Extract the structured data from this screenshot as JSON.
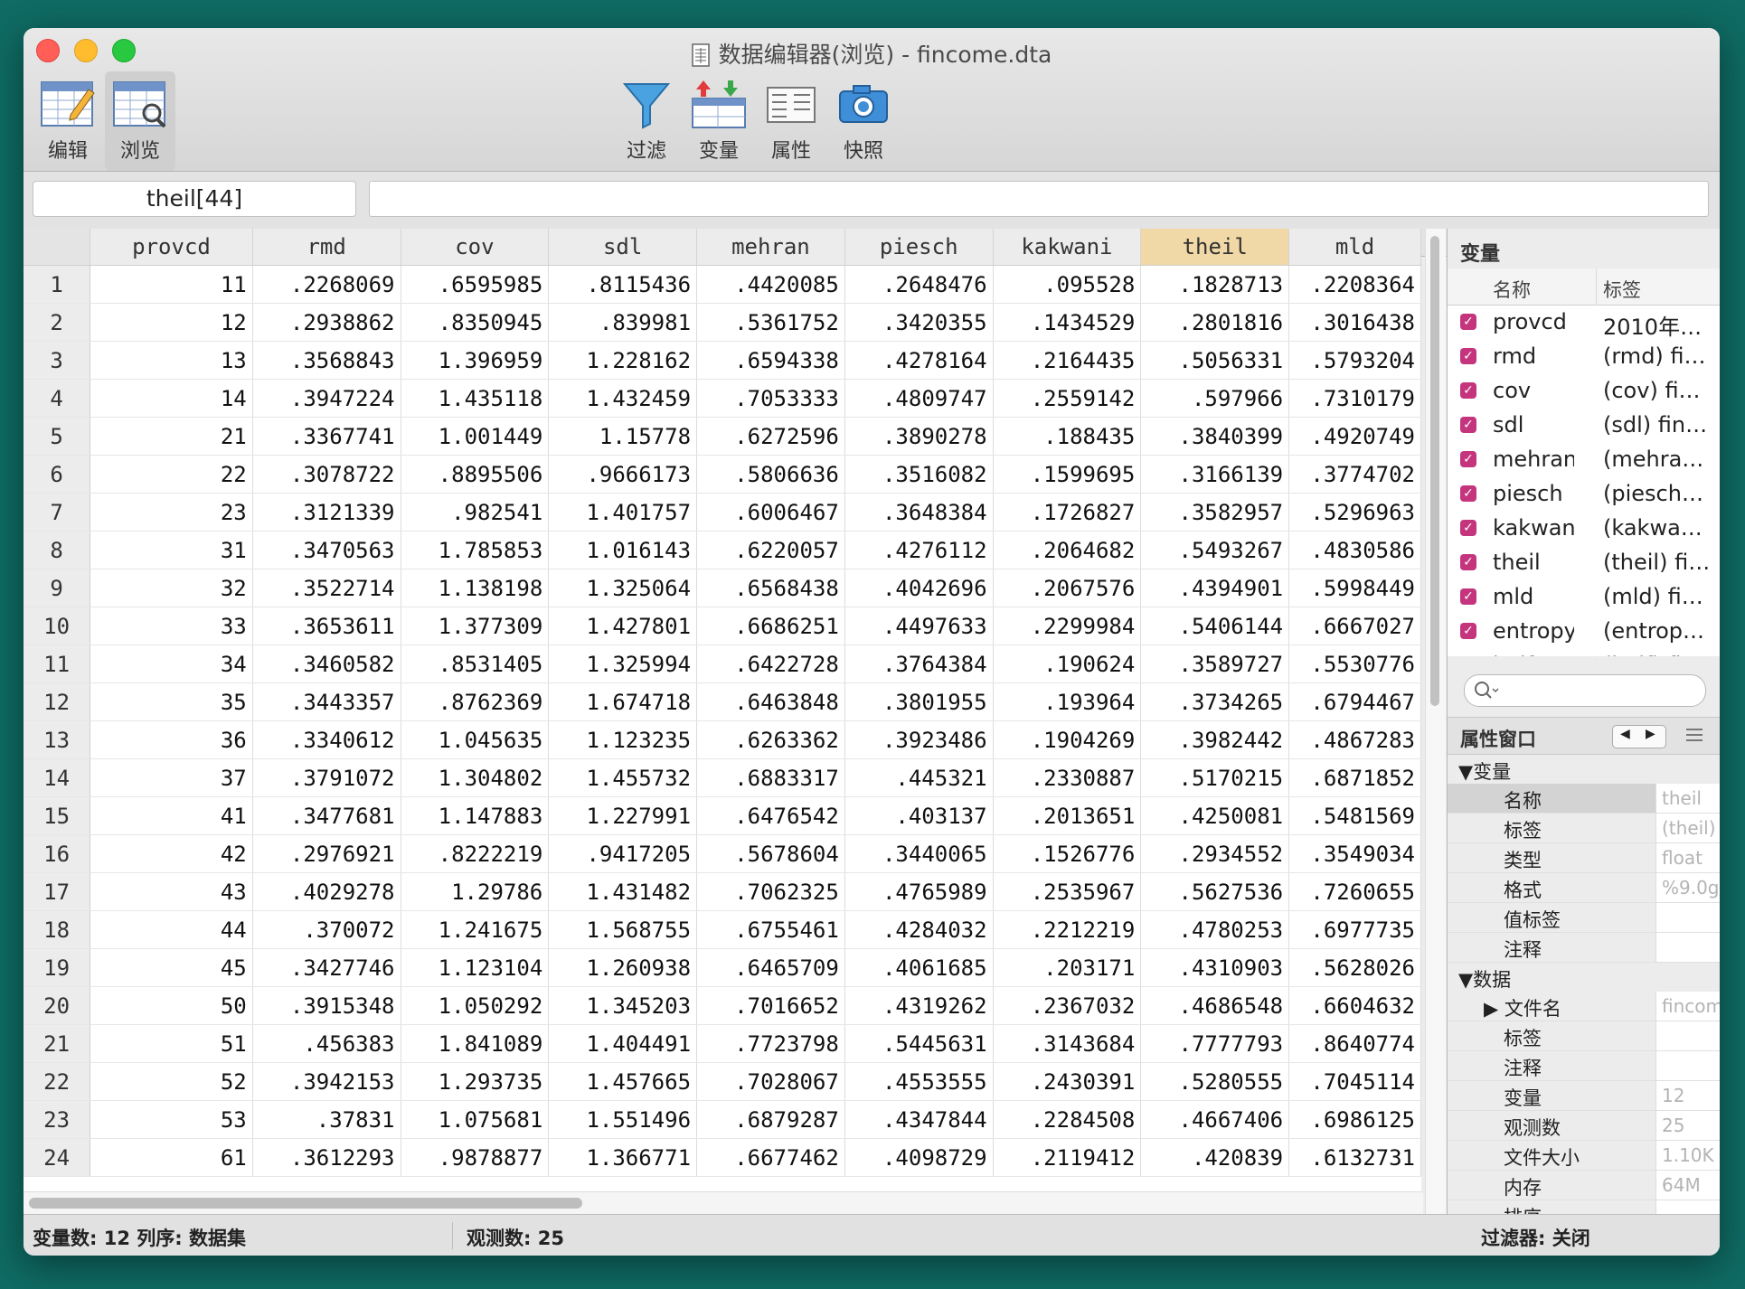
{
  "window": {
    "title": "数据编辑器(浏览) - fincome.dta"
  },
  "toolbar": {
    "edit_label": "编辑",
    "browse_label": "浏览",
    "filter_label": "过滤",
    "variables_label": "变量",
    "properties_label": "属性",
    "snapshot_label": "快照"
  },
  "cellbar": {
    "reference": "theil[44]",
    "value": ""
  },
  "grid": {
    "selected_column": "theil",
    "columns": [
      "provcd",
      "rmd",
      "cov",
      "sdl",
      "mehran",
      "piesch",
      "kakwani",
      "theil",
      "mld"
    ],
    "rows": [
      [
        "1",
        "11",
        ".2268069",
        ".6595985",
        ".8115436",
        ".4420085",
        ".2648476",
        ".095528",
        ".1828713",
        ".2208364"
      ],
      [
        "2",
        "12",
        ".2938862",
        ".8350945",
        ".839981",
        ".5361752",
        ".3420355",
        ".1434529",
        ".2801816",
        ".3016438"
      ],
      [
        "3",
        "13",
        ".3568843",
        "1.396959",
        "1.228162",
        ".6594338",
        ".4278164",
        ".2164435",
        ".5056331",
        ".5793204"
      ],
      [
        "4",
        "14",
        ".3947224",
        "1.435118",
        "1.432459",
        ".7053333",
        ".4809747",
        ".2559142",
        ".597966",
        ".7310179"
      ],
      [
        "5",
        "21",
        ".3367741",
        "1.001449",
        "1.15778",
        ".6272596",
        ".3890278",
        ".188435",
        ".3840399",
        ".4920749"
      ],
      [
        "6",
        "22",
        ".3078722",
        ".8895506",
        ".9666173",
        ".5806636",
        ".3516082",
        ".1599695",
        ".3166139",
        ".3774702"
      ],
      [
        "7",
        "23",
        ".3121339",
        ".982541",
        "1.401757",
        ".6006467",
        ".3648384",
        ".1726827",
        ".3582957",
        ".5296963"
      ],
      [
        "8",
        "31",
        ".3470563",
        "1.785853",
        "1.016143",
        ".6220057",
        ".4276112",
        ".2064682",
        ".5493267",
        ".4830586"
      ],
      [
        "9",
        "32",
        ".3522714",
        "1.138198",
        "1.325064",
        ".6568438",
        ".4042696",
        ".2067576",
        ".4394901",
        ".5998449"
      ],
      [
        "10",
        "33",
        ".3653611",
        "1.377309",
        "1.427801",
        ".6686251",
        ".4497633",
        ".2299984",
        ".5406144",
        ".6667027"
      ],
      [
        "11",
        "34",
        ".3460582",
        ".8531405",
        "1.325994",
        ".6422728",
        ".3764384",
        ".190624",
        ".3589727",
        ".5530776"
      ],
      [
        "12",
        "35",
        ".3443357",
        ".8762369",
        "1.674718",
        ".6463848",
        ".3801955",
        ".193964",
        ".3734265",
        ".6794467"
      ],
      [
        "13",
        "36",
        ".3340612",
        "1.045635",
        "1.123235",
        ".6263362",
        ".3923486",
        ".1904269",
        ".3982442",
        ".4867283"
      ],
      [
        "14",
        "37",
        ".3791072",
        "1.304802",
        "1.455732",
        ".6883317",
        ".445321",
        ".2330887",
        ".5170215",
        ".6871852"
      ],
      [
        "15",
        "41",
        ".3477681",
        "1.147883",
        "1.227991",
        ".6476542",
        ".403137",
        ".2013651",
        ".4250081",
        ".5481569"
      ],
      [
        "16",
        "42",
        ".2976921",
        ".8222219",
        ".9417205",
        ".5678604",
        ".3440065",
        ".1526776",
        ".2934552",
        ".3549034"
      ],
      [
        "17",
        "43",
        ".4029278",
        "1.29786",
        "1.431482",
        ".7062325",
        ".4765989",
        ".2535967",
        ".5627536",
        ".7260655"
      ],
      [
        "18",
        "44",
        ".370072",
        "1.241675",
        "1.568755",
        ".6755461",
        ".4284032",
        ".2212219",
        ".4780253",
        ".6977735"
      ],
      [
        "19",
        "45",
        ".3427746",
        "1.123104",
        "1.260938",
        ".6465709",
        ".4061685",
        ".203171",
        ".4310903",
        ".5628026"
      ],
      [
        "20",
        "50",
        ".3915348",
        "1.050292",
        "1.345203",
        ".7016652",
        ".4319262",
        ".2367032",
        ".4686548",
        ".6604632"
      ],
      [
        "21",
        "51",
        ".456383",
        "1.841089",
        "1.404491",
        ".7723798",
        ".5445631",
        ".3143684",
        ".7777793",
        ".8640774"
      ],
      [
        "22",
        "52",
        ".3942153",
        "1.293735",
        "1.457665",
        ".7028067",
        ".4553555",
        ".2430391",
        ".5280555",
        ".7045114"
      ],
      [
        "23",
        "53",
        ".37831",
        "1.075681",
        "1.551496",
        ".6879287",
        ".4347844",
        ".2284508",
        ".4667406",
        ".6986125"
      ],
      [
        "24",
        "61",
        ".3612293",
        ".9878877",
        "1.366771",
        ".6677462",
        ".4098729",
        ".2119412",
        ".420839",
        ".6132731"
      ]
    ]
  },
  "variables_panel": {
    "title": "变量",
    "col_name": "名称",
    "col_label": "标签",
    "items": [
      {
        "name": "provcd",
        "label": "2010年…"
      },
      {
        "name": "rmd",
        "label": "(rmd) fi…"
      },
      {
        "name": "cov",
        "label": "(cov) fi…"
      },
      {
        "name": "sdl",
        "label": "(sdl) fin…"
      },
      {
        "name": "mehran",
        "label": "(mehra…"
      },
      {
        "name": "piesch",
        "label": "(piesch…"
      },
      {
        "name": "kakwani",
        "label": "(kakwa…"
      },
      {
        "name": "theil",
        "label": "(theil) fi…"
      },
      {
        "name": "mld",
        "label": "(mld) fi…"
      },
      {
        "name": "entropy",
        "label": "(entrop…"
      },
      {
        "name": "half",
        "label": "(half) fi…"
      }
    ],
    "search_placeholder": ""
  },
  "properties_panel": {
    "title": "属性窗口",
    "rows": [
      {
        "type": "section",
        "key": "▼变量",
        "value": ""
      },
      {
        "type": "row",
        "key": "名称",
        "value": "theil",
        "selected": true
      },
      {
        "type": "row",
        "key": "标签",
        "value": "(theil)"
      },
      {
        "type": "row",
        "key": "类型",
        "value": "float"
      },
      {
        "type": "row",
        "key": "格式",
        "value": "%9.0g"
      },
      {
        "type": "row",
        "key": "值标签",
        "value": ""
      },
      {
        "type": "row",
        "key": "注释",
        "value": ""
      },
      {
        "type": "section",
        "key": "▼数据",
        "value": ""
      },
      {
        "type": "row",
        "key": "▶ 文件名",
        "value": "fincome"
      },
      {
        "type": "row",
        "key": "标签",
        "value": ""
      },
      {
        "type": "row",
        "key": "注释",
        "value": ""
      },
      {
        "type": "row",
        "key": "变量",
        "value": "12"
      },
      {
        "type": "row",
        "key": "观测数",
        "value": "25"
      },
      {
        "type": "row",
        "key": "文件大小",
        "value": "1.10K"
      },
      {
        "type": "row",
        "key": "内存",
        "value": "64M"
      },
      {
        "type": "row",
        "key": "排序",
        "value": ""
      }
    ]
  },
  "statusbar": {
    "vars": "变量数: 12  列序: 数据集",
    "obs": "观测数: 25",
    "filter": "过滤器: 关闭"
  },
  "colors": {
    "selected_header": "#f0d9a6",
    "checkbox": "#c4357e",
    "desktop": "#0f6b64"
  }
}
